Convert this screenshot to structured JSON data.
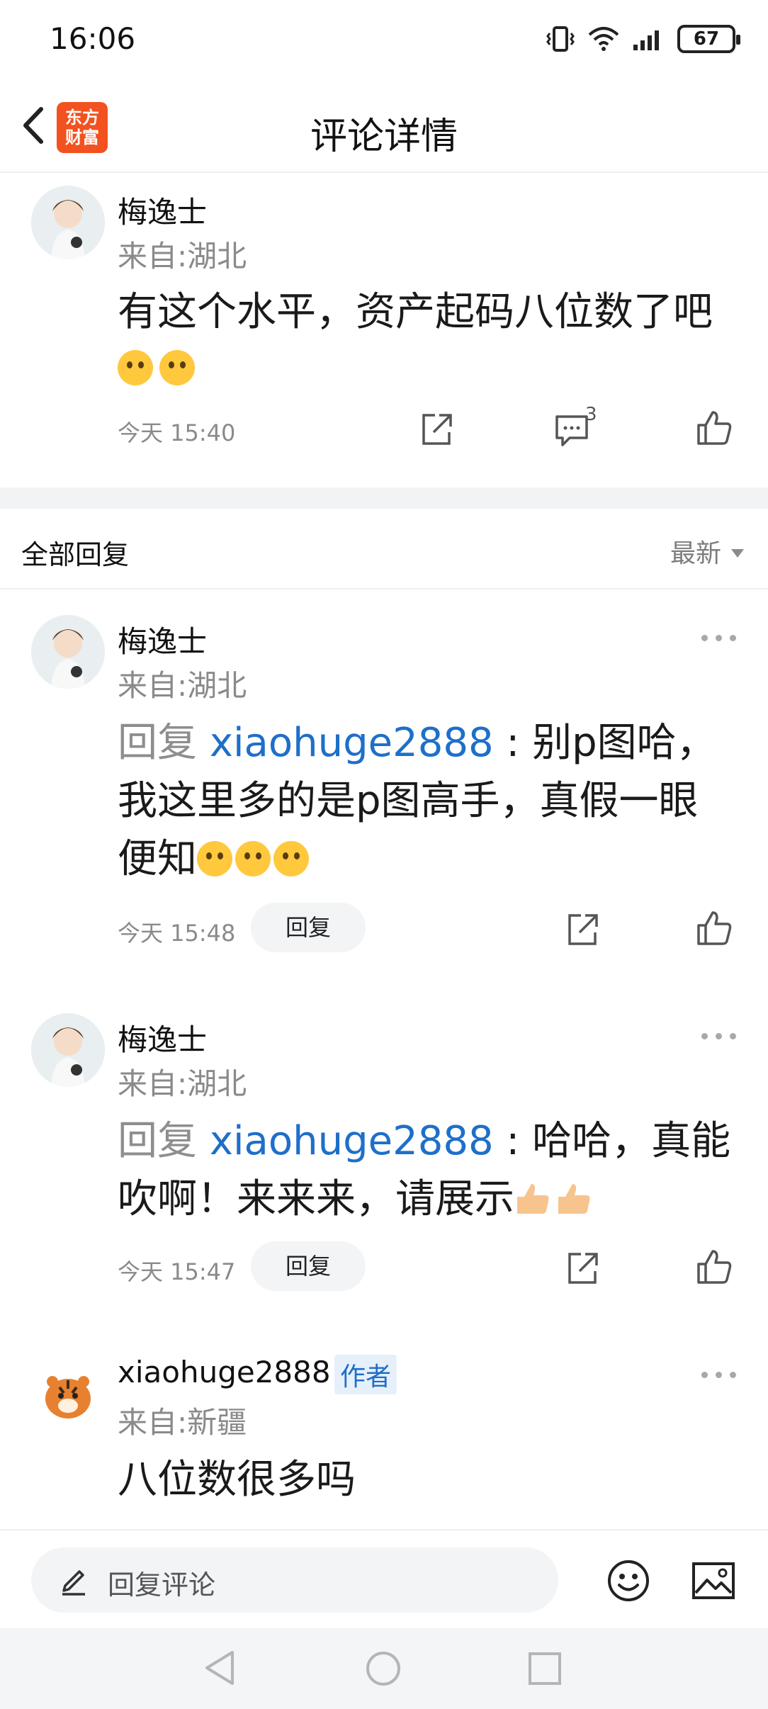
{
  "status_bar": {
    "time": "16:06",
    "battery": "67"
  },
  "header": {
    "title": "评论详情",
    "logo_line1": "东方",
    "logo_line2": "财富"
  },
  "main_comment": {
    "username": "梅逸士",
    "location": "来自:湖北",
    "text": "有这个水平，资产起码八位数了吧",
    "time": "今天 15:40",
    "reply_count": "3"
  },
  "section": {
    "title": "全部回复",
    "sort": "最新"
  },
  "replies": [
    {
      "username": "梅逸士",
      "location": "来自:湖北",
      "reply_prefix": "回复 ",
      "reply_to": "xiaohuge2888",
      "text_line1": " : 别p图哈，",
      "text_line2": "我这里多的是p图高手，真假一眼",
      "text_line3": "便知",
      "time": "今天 15:48",
      "reply_button": "回复"
    },
    {
      "username": "梅逸士",
      "location": "来自:湖北",
      "reply_prefix": "回复 ",
      "reply_to": "xiaohuge2888",
      "text_line1": " : 哈哈，真能",
      "text_line2": "吹啊！来来来，请展示",
      "time": "今天 15:47",
      "reply_button": "回复"
    },
    {
      "username": "xiaohuge2888",
      "badge": "作者",
      "location": "来自:新疆",
      "text": "八位数很多吗"
    }
  ],
  "bottom_bar": {
    "placeholder": "回复评论"
  }
}
